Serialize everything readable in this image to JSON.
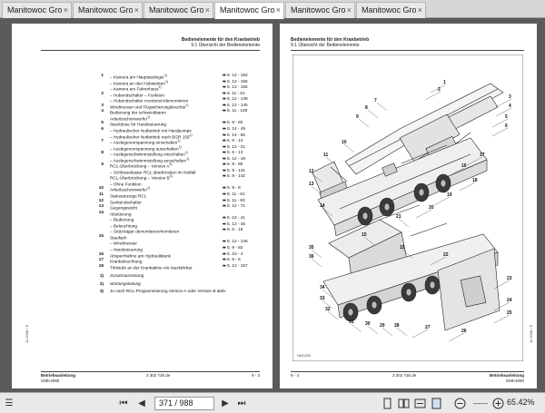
{
  "tabs": [
    {
      "label": "Manitowoc Grove Cra...",
      "active": false
    },
    {
      "label": "Manitowoc Grove Cra...",
      "active": false
    },
    {
      "label": "Manitowoc Grove Cra...",
      "active": false
    },
    {
      "label": "Manitowoc Grove Cran...",
      "active": true
    },
    {
      "label": "Manitowoc Grove Cra...",
      "active": false
    },
    {
      "label": "Manitowoc Grove Cra...",
      "active": false
    }
  ],
  "tab_close_glyph": "×",
  "left_page": {
    "header_line1": "Bedienelemente für den Kranbetrieb",
    "header_line2": "9.1 Übersicht der Bedienelemente",
    "side_code": "11.2008 / K",
    "entries": [
      {
        "num": "1",
        "text": "– Kamera am Hauptausleger",
        "sup": "1)",
        "ref": "S. 12 - 152"
      },
      {
        "num": "",
        "text": "– Kamera an den Hubwerken",
        "sup": "1)",
        "ref": "S. 12 - 155"
      },
      {
        "num": "",
        "text": "– Kamera am Fahrerhaus",
        "sup": "1)",
        "ref": "S. 12 - 155"
      },
      {
        "num": "2",
        "text": "– Hubendschalter – Funktion",
        "sup": "",
        "ref": "S. 11 - 61"
      },
      {
        "num": "",
        "text": "– Hubendschalter montieren/demontieren",
        "sup": "",
        "ref": "S. 12 - 139"
      },
      {
        "num": "3",
        "text": "Windmesser und Flugsicherungsleuchte",
        "sup": "1)",
        "ref": "S. 12 - 145"
      },
      {
        "num": "4",
        "text": "Bedienung der schwenkbaren",
        "sup": "",
        "ref": "S. 11 - 128"
      },
      {
        "num": "",
        "text": "Arbeitsscheinwerfer",
        "sup": "1)",
        "ref": ""
      },
      {
        "num": "5",
        "text": "Steckdose für Handsteuerung",
        "sup": "",
        "ref": "S. 9 - 82"
      },
      {
        "num": "6",
        "text": "– Hydraulischer Notbetrieb mit Handpumpe",
        "sup": "",
        "ref": "S. 14 - 49"
      },
      {
        "num": "",
        "text": "– Hydraulischer Notbetrieb nach BGR 159",
        "sup": "1)",
        "ref": "S. 14 - 56"
      },
      {
        "num": "7",
        "text": "– Auslegervorspannung einschalten",
        "sup": "1)",
        "ref": "S. 6 - 14"
      },
      {
        "num": "",
        "text": "– Auslegervorspannung ausschalten",
        "sup": "1)",
        "ref": "S. 12 - 21"
      },
      {
        "num": "8",
        "text": "– Auslegerschwimmstellung einschalten",
        "sup": "1)",
        "ref": "S. 6 - 13"
      },
      {
        "num": "",
        "text": "– Auslegerschwimmstellung ausschalten",
        "sup": "1)",
        "ref": "S. 12 - 19"
      },
      {
        "num": "9",
        "text": "RCL-Überbrückung – Version A",
        "sup": "3)",
        "ref": "S. 9 - 80"
      },
      {
        "num": "",
        "text": "– Schlüsseltaster RCL überbrücken im Notfall",
        "sup": "",
        "ref": "S. 9 - 141"
      },
      {
        "num": "",
        "text": "RCL-Überbrückung – Version B",
        "sup": "3)",
        "ref": "S. 9 - 142"
      },
      {
        "num": "",
        "text": "– Ohne Funktion",
        "sup": "",
        "ref": ""
      },
      {
        "num": "10",
        "text": "Arbeitsscheinwerfer",
        "sup": "1)",
        "ref": "S. 9 - 8"
      },
      {
        "num": "11",
        "text": "Statusanzeige RCL",
        "sup": "",
        "ref": "S. 11 - 61"
      },
      {
        "num": "12",
        "text": "Senkendschalter",
        "sup": "",
        "ref": "S. 11 - 83"
      },
      {
        "num": "13",
        "text": "Gegengewicht",
        "sup": "",
        "ref": "S. 12 - 71"
      },
      {
        "num": "14",
        "text": "Abstützung",
        "sup": "",
        "ref": ""
      },
      {
        "num": "",
        "text": "– Bedienung",
        "sup": "",
        "ref": "S. 12 - 41"
      },
      {
        "num": "",
        "text": "– Beleuchtung",
        "sup": "",
        "ref": "S. 12 - 45"
      },
      {
        "num": "",
        "text": "– Stützträger demontieren/montieren",
        "sup": "",
        "ref": "S. 6 - 15"
      },
      {
        "num": "15",
        "text": "Staufach",
        "sup": "",
        "ref": ""
      },
      {
        "num": "",
        "text": "– Windmesser",
        "sup": "",
        "ref": "S. 12 - 145"
      },
      {
        "num": "",
        "text": "– Handsteuerung",
        "sup": "",
        "ref": "S. 9 - 82"
      },
      {
        "num": "16",
        "text": "Absperrhähne am Hydrauliktank",
        "sup": "",
        "ref": "S. 10 - 4"
      },
      {
        "num": "17",
        "text": "Kranbeleuchtung",
        "sup": "",
        "ref": "S. 9 - 6"
      },
      {
        "num": "18",
        "text": "Trittstufe an der Krankabine ein-/ausfahrbar",
        "sup": "",
        "ref": "S. 12 - 157"
      }
    ],
    "notes": [
      {
        "sym": "1)",
        "text": "Zusatzausrüstung"
      },
      {
        "sym": "2)",
        "text": "Wartungsleitung"
      },
      {
        "sym": "3)",
        "text": "Je nach RCL-Programmierung Version A oder Version B aktiv"
      }
    ],
    "footer_left_1": "Betriebsanleitung",
    "footer_left_2": "GMK4080",
    "footer_center": "3 302 735 de",
    "footer_right": "9 - 3"
  },
  "right_page": {
    "header_line1": "Bedienelemente für den Kranbetrieb",
    "header_line2": "9.1 Übersicht der Bedienelemente",
    "side_code": "11.2008 / K",
    "footer_left": "9 - 4",
    "footer_center": "3 302 735 de",
    "footer_right_1": "Betriebsanleitung",
    "footer_right_2": "GMK4080",
    "figure_code": "HAZ1234",
    "callouts_top": [
      "1",
      "2",
      "3",
      "4",
      "5",
      "6",
      "7",
      "8",
      "9",
      "10",
      "11",
      "12",
      "13",
      "14",
      "15",
      "16",
      "17",
      "18",
      "19",
      "20",
      "21"
    ],
    "callouts_bottom": [
      "22",
      "23",
      "24",
      "25",
      "26",
      "27",
      "28",
      "29",
      "30",
      "31",
      "32",
      "33",
      "34",
      "35",
      "36",
      "15"
    ]
  },
  "statusbar": {
    "current_page": "371 / 988",
    "zoom": "65.42%",
    "icons": [
      "first-page-icon",
      "prev-page-icon",
      "next-page-icon",
      "last-page-icon",
      "single-page-icon",
      "two-page-icon",
      "fit-width-icon",
      "fit-page-icon",
      "zoom-out-icon",
      "zoom-in-icon"
    ]
  }
}
